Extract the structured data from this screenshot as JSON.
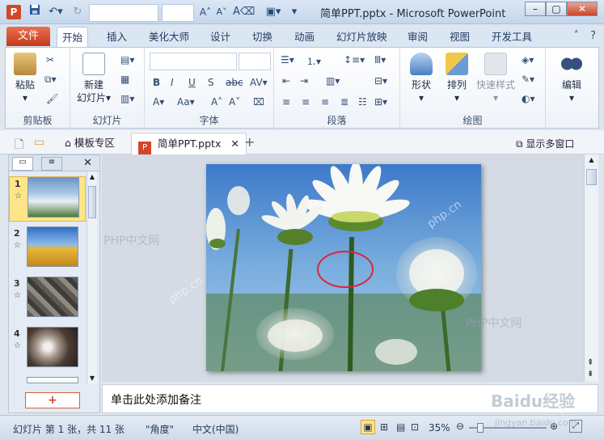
{
  "titlebar": {
    "title": "简单PPT.pptx - Microsoft PowerPoint",
    "app_icon": "P"
  },
  "tabs": {
    "file": "文件",
    "items": [
      "开始",
      "插入",
      "美化大师",
      "设计",
      "切换",
      "动画",
      "幻灯片放映",
      "审阅",
      "视图",
      "开发工具"
    ]
  },
  "ribbon": {
    "clipboard": {
      "paste": "粘贴",
      "label": "剪贴板"
    },
    "slides": {
      "new_slide_line1": "新建",
      "new_slide_line2": "幻灯片",
      "label": "幻灯片"
    },
    "font": {
      "label": "字体"
    },
    "paragraph": {
      "label": "段落"
    },
    "drawing": {
      "shape": "形状",
      "arrange": "排列",
      "quick_style": "快速样式",
      "label": "绘图"
    },
    "editing": {
      "label": "编辑"
    }
  },
  "docbar": {
    "template_tab": "模板专区",
    "doc_tab": "简单PPT.pptx",
    "multi_window": "显示多窗口"
  },
  "slides_panel": {
    "thumbnails": [
      {
        "num": "1",
        "star": "☆"
      },
      {
        "num": "2",
        "star": "☆"
      },
      {
        "num": "3",
        "star": "☆"
      },
      {
        "num": "4",
        "star": "☆"
      }
    ],
    "add_button": "+"
  },
  "notes": {
    "placeholder": "单击此处添加备注"
  },
  "statusbar": {
    "slide_info": "幻灯片 第 1 张，共 11 张",
    "theme": "\"角度\"",
    "language": "中文(中国)",
    "zoom": "35%"
  },
  "watermarks": [
    "PHP中文网",
    "php.cn",
    "Baidu经验",
    "jingyan.baidu.com"
  ],
  "colors": {
    "accent": "#d24726",
    "ribbon_bg": "#eef3f9",
    "selection": "#fde58a"
  }
}
